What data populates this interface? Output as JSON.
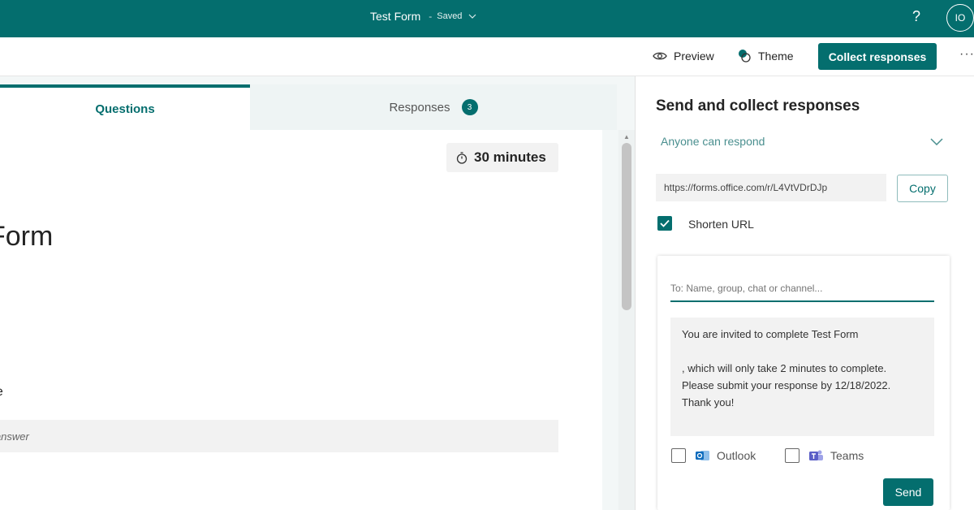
{
  "header": {
    "form_title": "Test Form",
    "separator": "-",
    "save_status": "Saved",
    "help_label": "?",
    "avatar_initials": "IO"
  },
  "toolbar": {
    "preview_label": "Preview",
    "theme_label": "Theme",
    "collect_label": "Collect responses",
    "more_label": "···"
  },
  "tabs": {
    "questions_label": "Questions",
    "responses_label": "Responses",
    "responses_count": "3"
  },
  "form": {
    "timer_label": "30 minutes",
    "heading_partial": "Form",
    "question_partial": "ne",
    "answer_placeholder_partial": "r answer"
  },
  "panel": {
    "title": "Send and collect responses",
    "audience": "Anyone can respond",
    "url": "https://forms.office.com/r/L4VtVDrDJp",
    "copy_label": "Copy",
    "shorten_label": "Shorten URL",
    "shorten_checked": true,
    "to_placeholder": "To: Name, group, chat or channel...",
    "message": {
      "line1": "You are invited to complete Test Form",
      "line2": ", which will only take 2 minutes to complete.",
      "line3": "Please submit your response by 12/18/2022.",
      "line4": "Thank you!"
    },
    "outlook_label": "Outlook",
    "teams_label": "Teams",
    "send_label": "Send"
  },
  "colors": {
    "brand": "#046e6e",
    "accent_text": "#4a8f8f",
    "outlook": "#0f6cbd",
    "teams": "#5b5fc7"
  },
  "icons": {
    "preview": "eye-icon",
    "theme": "palette-icon",
    "timer": "stopwatch-icon",
    "audience_dropdown": "chevron-down-icon",
    "outlook": "outlook-icon",
    "teams": "teams-icon"
  }
}
